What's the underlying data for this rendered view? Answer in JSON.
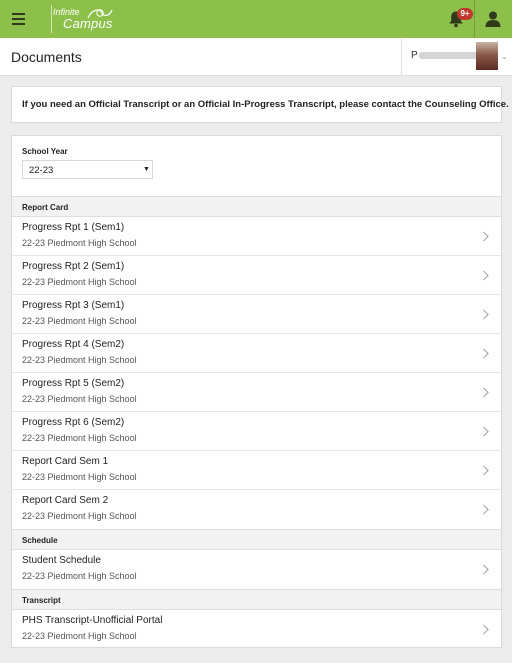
{
  "header": {
    "logo_top": "Infinite",
    "logo_bottom": "Campus",
    "notification_badge": "9+",
    "accent_color": "#8cc04a"
  },
  "page": {
    "title": "Documents",
    "student_initial": "P"
  },
  "notice": {
    "text": "If you need an Official Transcript or an Official In-Progress Transcript, please contact the Counseling Office."
  },
  "school_year": {
    "label": "School Year",
    "value": "22-23"
  },
  "sections": [
    {
      "heading": "Report Card",
      "items": [
        {
          "title": "Progress Rpt 1 (Sem1)",
          "subtitle": "22-23 Piedmont High School"
        },
        {
          "title": "Progress Rpt 2 (Sem1)",
          "subtitle": "22-23 Piedmont High School"
        },
        {
          "title": "Progress Rpt 3 (Sem1)",
          "subtitle": "22-23 Piedmont High School"
        },
        {
          "title": "Progress Rpt 4 (Sem2)",
          "subtitle": "22-23 Piedmont High School"
        },
        {
          "title": "Progress Rpt 5 (Sem2)",
          "subtitle": "22-23 Piedmont High School"
        },
        {
          "title": "Progress Rpt 6 (Sem2)",
          "subtitle": "22-23 Piedmont High School"
        },
        {
          "title": "Report Card Sem 1",
          "subtitle": "22-23 Piedmont High School"
        },
        {
          "title": "Report Card Sem 2",
          "subtitle": "22-23 Piedmont High School"
        }
      ]
    },
    {
      "heading": "Schedule",
      "items": [
        {
          "title": "Student Schedule",
          "subtitle": "22-23 Piedmont High School"
        }
      ]
    },
    {
      "heading": "Transcript",
      "items": [
        {
          "title": "PHS Transcript-Unofficial Portal",
          "subtitle": "22-23 Piedmont High School"
        }
      ]
    }
  ]
}
